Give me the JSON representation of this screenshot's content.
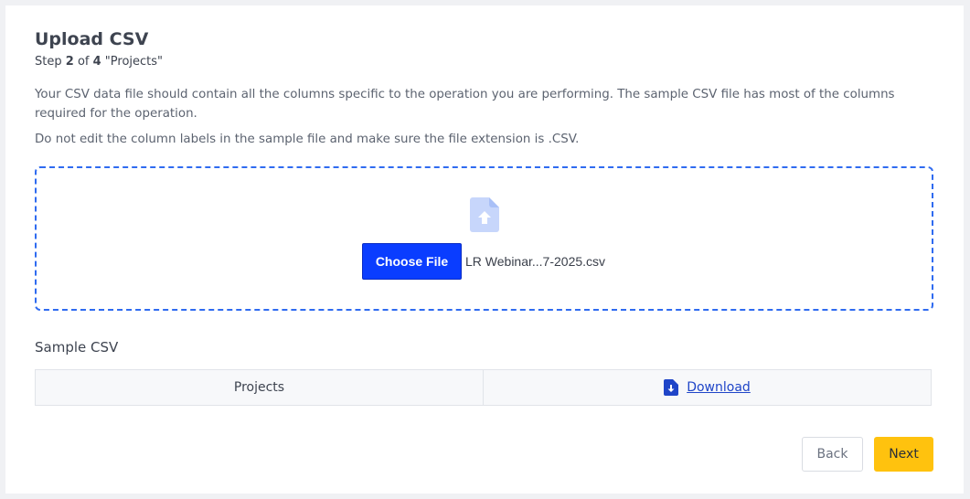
{
  "header": {
    "title": "Upload CSV",
    "step_prefix": "Step",
    "step_current": "2",
    "step_of": "of",
    "step_total": "4",
    "step_name": "\"Projects\""
  },
  "description": {
    "line1": "Your CSV data file should contain all the columns specific to the operation you are performing. The sample CSV file has most of the columns required for the operation.",
    "line2": "Do not edit the column labels in the sample file and make sure the file extension is .CSV."
  },
  "upload": {
    "icon": "file-upload-icon",
    "choose_label": "Choose File",
    "file_name": "LR Webinar...7-2025.csv"
  },
  "sample": {
    "title": "Sample CSV",
    "name": "Projects",
    "download_icon": "file-download-icon",
    "download_label": "Download"
  },
  "footer": {
    "back_label": "Back",
    "next_label": "Next"
  },
  "colors": {
    "primary": "#0a3dff",
    "accent": "#ffc20e",
    "dropzone_border": "#2f6bf0",
    "link": "#1f45c8"
  }
}
